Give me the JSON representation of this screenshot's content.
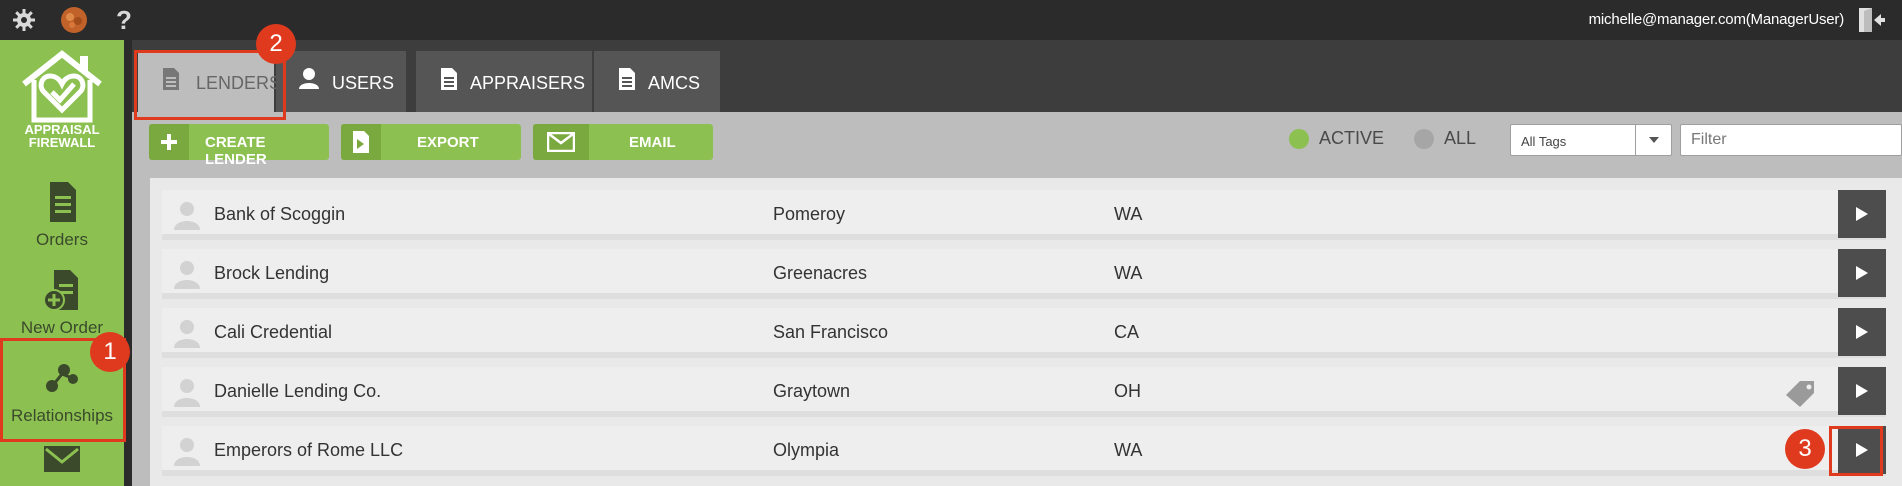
{
  "topbar": {
    "icons": [
      "gear-icon",
      "avatar-image",
      "help-icon"
    ],
    "help_glyph": "?",
    "user_label": "michelle@manager.com(ManagerUser)",
    "logout_icon": "logout-icon"
  },
  "sidebar": {
    "logo": {
      "line1": "APPRAISAL",
      "line2": "FIREWALL"
    },
    "items": [
      {
        "label": "Orders",
        "icon": "document-icon"
      },
      {
        "label": "New Order",
        "icon": "new-order-icon"
      },
      {
        "label": "Relationships",
        "icon": "relationships-icon"
      },
      {
        "label": "",
        "icon": "mail-icon"
      }
    ]
  },
  "tabs": [
    {
      "label": "LENDERS",
      "icon": "document-icon",
      "active": true
    },
    {
      "label": "USERS",
      "icon": "user-icon",
      "active": false
    },
    {
      "label": "APPRAISERS",
      "icon": "document-icon",
      "active": false
    },
    {
      "label": "AMCS",
      "icon": "document-icon",
      "active": false
    }
  ],
  "toolbar": {
    "create_label": "CREATE LENDER",
    "export_label": "EXPORT",
    "email_label": "EMAIL",
    "active_label": "ACTIVE",
    "all_label": "ALL",
    "active_color": "#8cc152",
    "all_color": "#a6a6a6",
    "tags_select_value": "All Tags",
    "filter_placeholder": "Filter"
  },
  "lenders": [
    {
      "name": "Bank of Scoggin",
      "city": "Pomeroy",
      "state": "WA",
      "tagged": false
    },
    {
      "name": "Brock Lending",
      "city": "Greenacres",
      "state": "WA",
      "tagged": false
    },
    {
      "name": "Cali Credential",
      "city": "San Francisco",
      "state": "CA",
      "tagged": false
    },
    {
      "name": "Danielle Lending Co.",
      "city": "Graytown",
      "state": "OH",
      "tagged": true
    },
    {
      "name": "Emperors of Rome LLC",
      "city": "Olympia",
      "state": "WA",
      "tagged": false
    }
  ],
  "annotations": {
    "badge1": "1",
    "badge2": "2",
    "badge3": "3",
    "color": "#e03a1e"
  }
}
